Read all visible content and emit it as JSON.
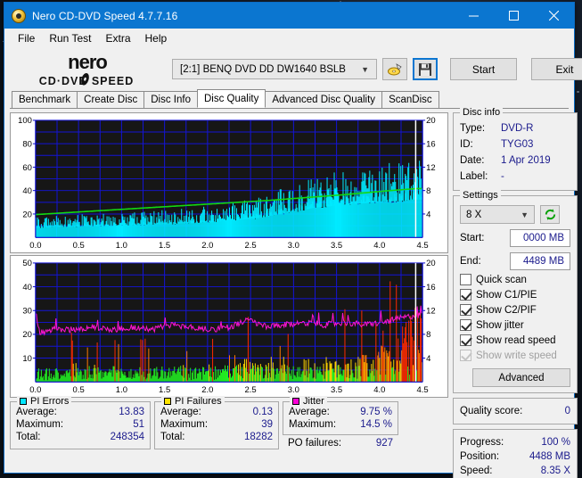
{
  "window": {
    "title": "Nero CD-DVD Speed 4.7.7.16",
    "icon": "nero-disc-icon",
    "minimize": "minimize-icon",
    "maximize": "maximize-icon",
    "close": "close-icon"
  },
  "menu": [
    "File",
    "Run Test",
    "Extra",
    "Help"
  ],
  "toolbar": {
    "logo_line1": "nero",
    "logo_line2": "CD·DVD SPEED",
    "drive": "[2:1]   BENQ DVD DD DW1640 BSLB",
    "eject_icon": "eject-disc-icon",
    "save_icon": "floppy-save-icon",
    "start_label": "Start",
    "exit_label": "Exit"
  },
  "tabs": [
    {
      "label": "Benchmark",
      "active": false
    },
    {
      "label": "Create Disc",
      "active": false
    },
    {
      "label": "Disc Info",
      "active": false
    },
    {
      "label": "Disc Quality",
      "active": true
    },
    {
      "label": "Advanced Disc Quality",
      "active": false
    },
    {
      "label": "ScanDisc",
      "active": false
    }
  ],
  "disc_info": {
    "title": "Disc info",
    "rows": [
      {
        "key": "Type:",
        "value": "DVD-R"
      },
      {
        "key": "ID:",
        "value": "TYG03"
      },
      {
        "key": "Date:",
        "value": "1 Apr 2019"
      },
      {
        "key": "Label:",
        "value": "-"
      }
    ]
  },
  "settings": {
    "title": "Settings",
    "speed": "8 X",
    "refresh_icon": "refresh-icon",
    "start_label": "Start:",
    "start_value": "0000 MB",
    "end_label": "End:",
    "end_value": "4489 MB",
    "checks": [
      {
        "label": "Quick scan",
        "checked": false,
        "disabled": false
      },
      {
        "label": "Show C1/PIE",
        "checked": true,
        "disabled": false
      },
      {
        "label": "Show C2/PIF",
        "checked": true,
        "disabled": false
      },
      {
        "label": "Show jitter",
        "checked": true,
        "disabled": false
      },
      {
        "label": "Show read speed",
        "checked": true,
        "disabled": false
      },
      {
        "label": "Show write speed",
        "checked": true,
        "disabled": true
      }
    ],
    "advanced_label": "Advanced"
  },
  "quality": {
    "label": "Quality score:",
    "value": "0"
  },
  "progress": [
    {
      "key": "Progress:",
      "value": "100 %"
    },
    {
      "key": "Position:",
      "value": "4488 MB"
    },
    {
      "key": "Speed:",
      "value": "8.35 X"
    }
  ],
  "stats": {
    "pi_errors": {
      "title": "PI Errors",
      "color": "#00e5ff",
      "rows": [
        {
          "key": "Average:",
          "value": "13.83"
        },
        {
          "key": "Maximum:",
          "value": "51"
        },
        {
          "key": "Total:",
          "value": "248354"
        }
      ]
    },
    "pi_failures": {
      "title": "PI Failures",
      "color": "#ffe400",
      "rows": [
        {
          "key": "Average:",
          "value": "0.13"
        },
        {
          "key": "Maximum:",
          "value": "39"
        },
        {
          "key": "Total:",
          "value": "18282"
        }
      ]
    },
    "jitter": {
      "title": "Jitter",
      "color": "#ff00d8",
      "rows": [
        {
          "key": "Average:",
          "value": "9.75 %"
        },
        {
          "key": "Maximum:",
          "value": "14.5 %"
        }
      ]
    },
    "po_failures": {
      "key": "PO failures:",
      "value": "927"
    }
  },
  "chart_data": [
    {
      "id": "pi-errors-chart",
      "type": "area",
      "title": "",
      "xlabel": "",
      "ylabel": "PI Errors",
      "x_ticks": [
        "0.0",
        "0.5",
        "1.0",
        "1.5",
        "2.0",
        "2.5",
        "3.0",
        "3.5",
        "4.0",
        "4.5"
      ],
      "xlim": [
        0,
        4.5
      ],
      "y_left_ticks": [
        20,
        40,
        60,
        80,
        100
      ],
      "ylim_left": [
        0,
        100
      ],
      "y_right_ticks": [
        4,
        8,
        12,
        16,
        20
      ],
      "ylim_right": [
        0,
        20
      ],
      "grid": true,
      "background": "#161616",
      "grid_color": "#1414d8",
      "series": [
        {
          "name": "PI Errors",
          "color": "#00eaff",
          "kind": "area",
          "axis": "left",
          "x": [
            0.0,
            0.11,
            0.23,
            0.34,
            0.45,
            0.56,
            0.68,
            0.79,
            0.9,
            1.01,
            1.13,
            1.24,
            1.35,
            1.46,
            1.58,
            1.69,
            1.8,
            1.91,
            2.03,
            2.14,
            2.25,
            2.36,
            2.48,
            2.59,
            2.7,
            2.81,
            2.93,
            3.04,
            3.15,
            3.26,
            3.38,
            3.49,
            3.6,
            3.71,
            3.83,
            3.94,
            4.05,
            4.16,
            4.28,
            4.39,
            4.45
          ],
          "values": [
            11,
            11,
            12,
            12,
            12,
            13,
            13,
            13,
            13,
            14,
            14,
            14,
            15,
            15,
            15,
            16,
            16,
            17,
            17,
            18,
            19,
            20,
            21,
            22,
            24,
            26,
            28,
            30,
            32,
            34,
            35,
            36,
            37,
            38,
            39,
            40,
            41,
            41,
            42,
            43,
            43
          ]
        },
        {
          "name": "Read speed",
          "color": "#12d912",
          "kind": "line",
          "axis": "right",
          "x": [
            0.0,
            0.45,
            0.9,
            1.35,
            1.8,
            2.25,
            2.7,
            3.15,
            3.6,
            4.05,
            4.45
          ],
          "values": [
            3.9,
            4.3,
            4.7,
            5.1,
            5.5,
            5.9,
            6.3,
            6.8,
            7.3,
            7.9,
            8.35
          ]
        }
      ]
    },
    {
      "id": "pif-jitter-chart",
      "type": "area",
      "title": "",
      "xlabel": "",
      "ylabel": "PI Failures",
      "x_ticks": [
        "0.0",
        "0.5",
        "1.0",
        "1.5",
        "2.0",
        "2.5",
        "3.0",
        "3.5",
        "4.0",
        "4.5"
      ],
      "xlim": [
        0,
        4.5
      ],
      "y_left_ticks": [
        10,
        20,
        30,
        40,
        50
      ],
      "ylim_left": [
        0,
        50
      ],
      "y_right_ticks": [
        4,
        8,
        12,
        16,
        20
      ],
      "ylim_right": [
        0,
        20
      ],
      "grid": true,
      "background": "#161616",
      "grid_color": "#1414d8",
      "series": [
        {
          "name": "PI Failures",
          "color": "#22ee22",
          "kind": "area",
          "axis": "left",
          "x": [
            0.0,
            0.11,
            0.23,
            0.34,
            0.45,
            0.56,
            0.68,
            0.79,
            0.9,
            1.01,
            1.13,
            1.24,
            1.35,
            1.46,
            1.58,
            1.69,
            1.8,
            1.91,
            2.03,
            2.14,
            2.25,
            2.36,
            2.48,
            2.59,
            2.7,
            2.81,
            2.93,
            3.04,
            3.15,
            3.26,
            3.38,
            3.49,
            3.6,
            3.71,
            3.83,
            3.94,
            4.05,
            4.16,
            4.28,
            4.39,
            4.45
          ],
          "values": [
            5,
            4,
            5,
            4,
            6,
            4,
            5,
            4,
            5,
            4,
            4,
            5,
            4,
            5,
            4,
            5,
            4,
            4,
            5,
            4,
            6,
            5,
            8,
            5,
            6,
            5,
            6,
            5,
            7,
            6,
            7,
            6,
            8,
            7,
            9,
            8,
            11,
            12,
            16,
            20,
            22
          ]
        },
        {
          "name": "Jitter",
          "color": "#ff14d4",
          "kind": "line",
          "axis": "left",
          "x": [
            0.0,
            0.05,
            0.23,
            0.45,
            0.68,
            0.9,
            1.13,
            1.35,
            1.58,
            1.8,
            2.03,
            2.25,
            2.48,
            2.7,
            2.93,
            3.15,
            3.38,
            3.6,
            3.83,
            4.05,
            4.28,
            4.45
          ],
          "values": [
            29,
            21,
            22,
            22,
            23,
            22,
            23,
            22,
            24,
            23,
            22,
            23,
            26,
            23,
            24,
            25,
            24,
            25,
            24,
            25,
            27,
            28
          ]
        }
      ]
    }
  ]
}
